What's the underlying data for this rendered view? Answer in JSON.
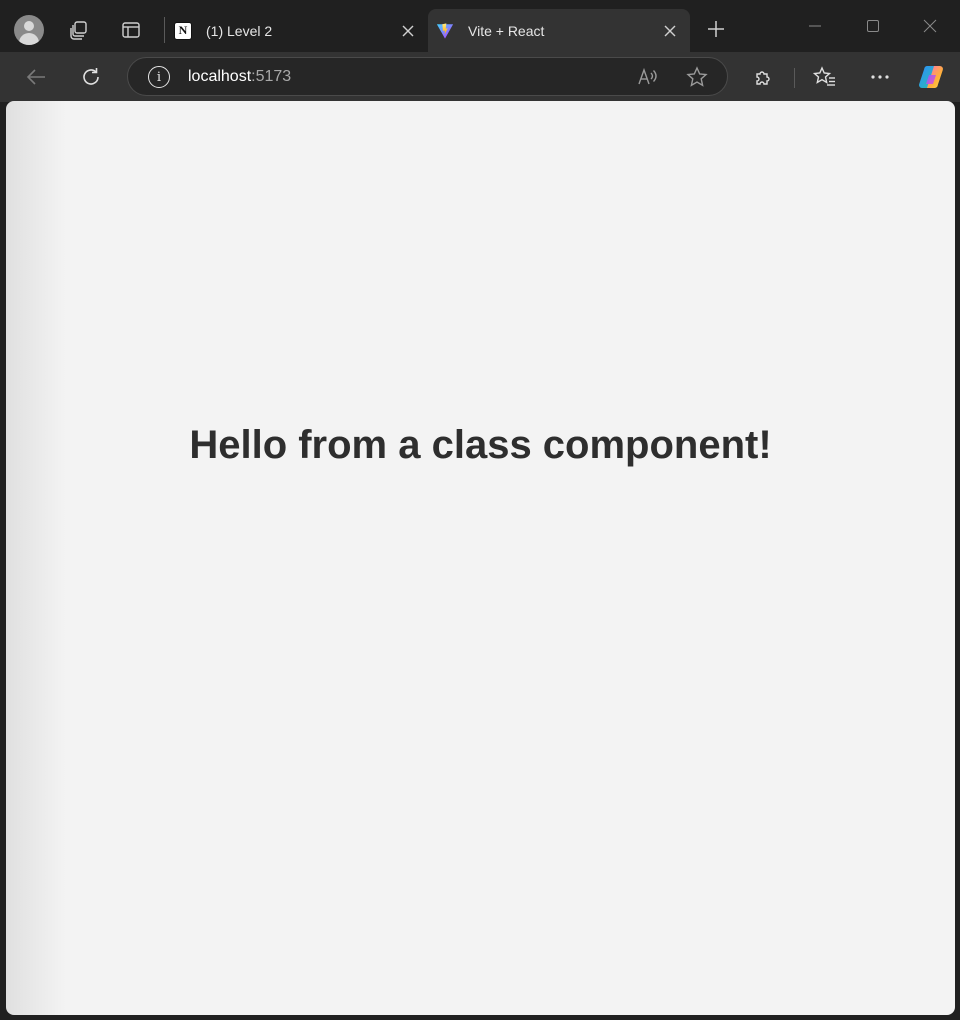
{
  "browser": {
    "tabs": [
      {
        "title": "(1) Level 2",
        "favicon": "notion-icon",
        "active": false
      },
      {
        "title": "Vite + React",
        "favicon": "vite-icon",
        "active": true
      }
    ],
    "address_bar": {
      "host": "localhost",
      "port": ":5173"
    },
    "colors": {
      "frame": "#202020",
      "toolbar": "#333333",
      "page_background": "#f3f3f3",
      "heading_text": "#2e2e2e"
    }
  },
  "page": {
    "heading": "Hello from a class component!"
  }
}
